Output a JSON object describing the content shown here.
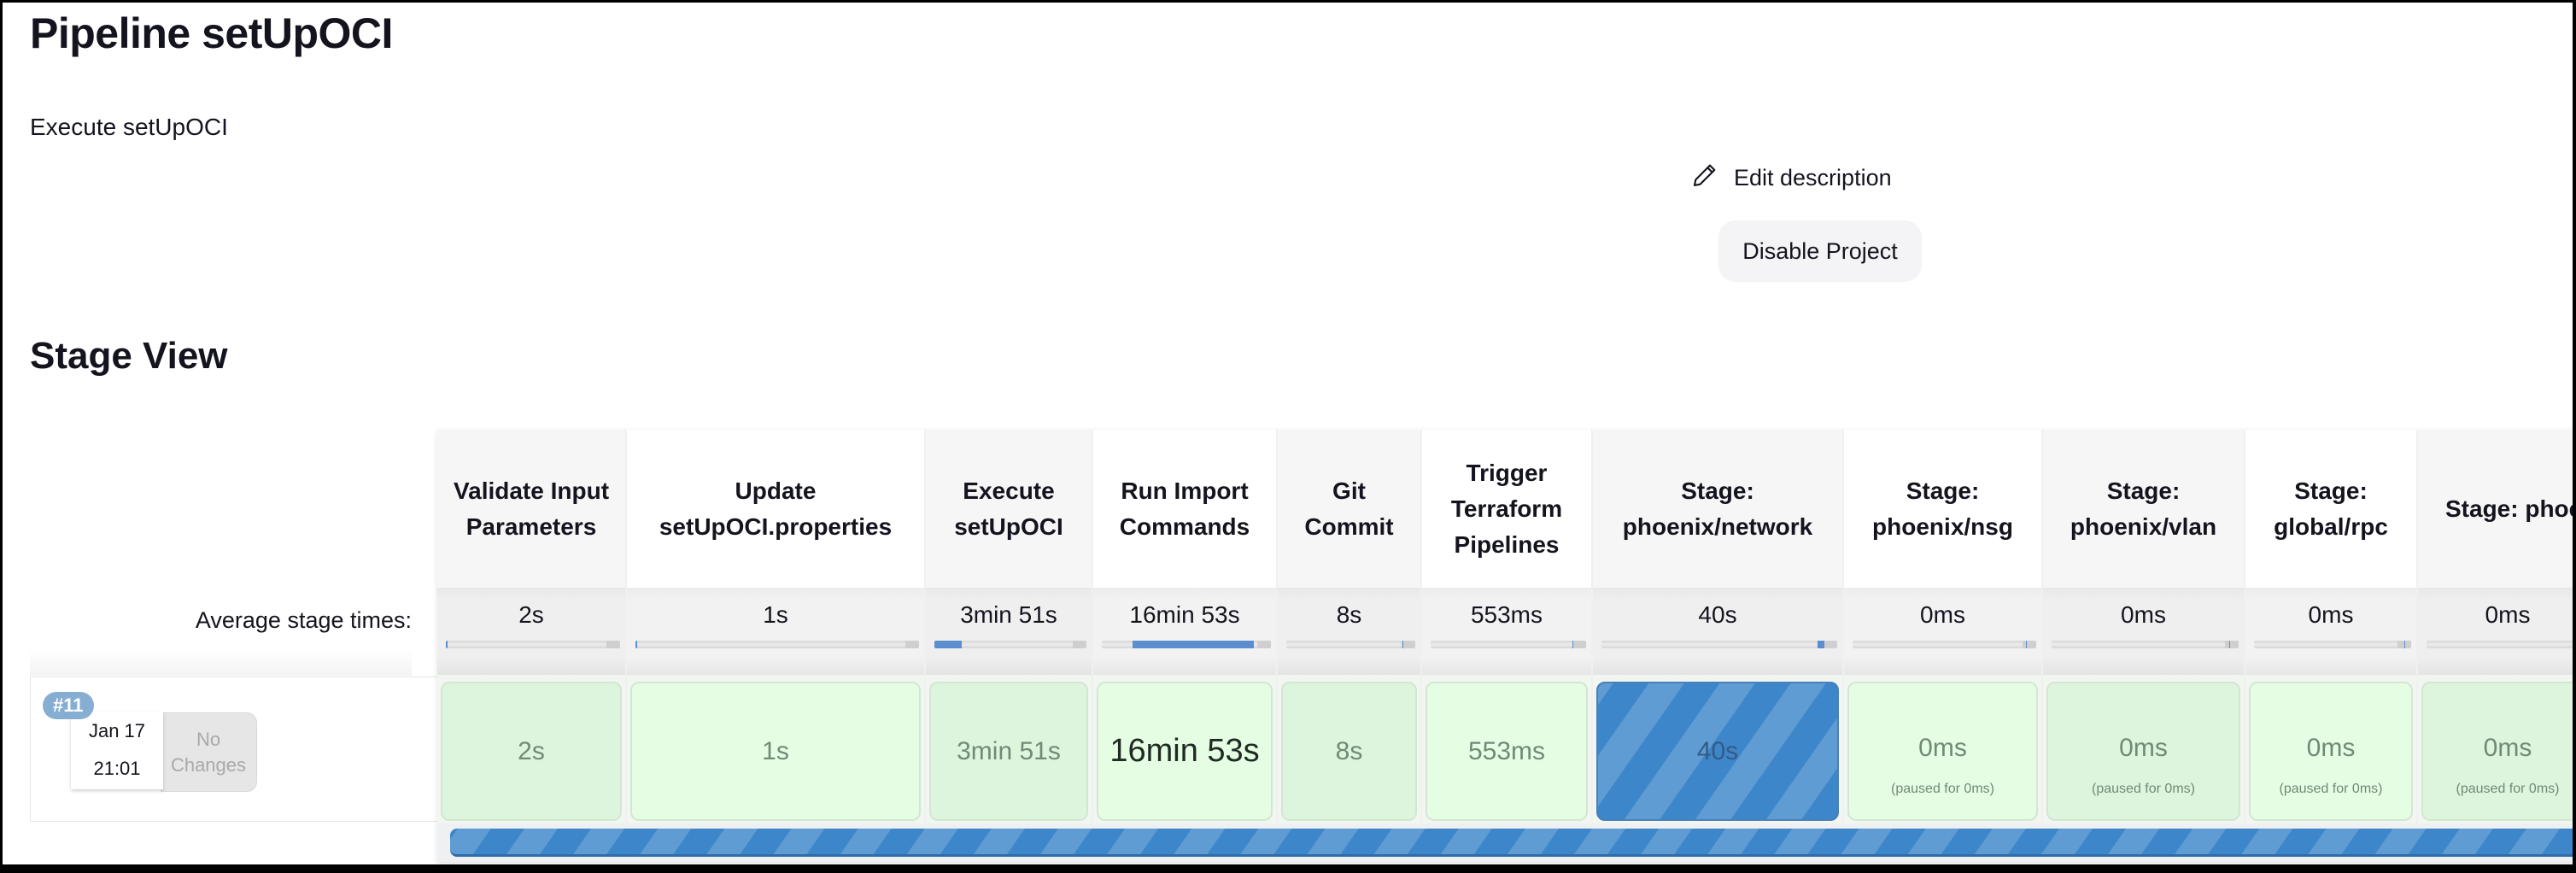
{
  "page": {
    "title": "Pipeline setUpOCI",
    "description": "Execute setUpOCI",
    "edit_description_label": "Edit description",
    "edit_description_icon": "pencil-icon",
    "disable_project_label": "Disable Project"
  },
  "stage_view": {
    "title": "Stage View",
    "average_label": "Average stage times:",
    "stages": [
      {
        "name": "Validate Input Parameters",
        "avg": "2s",
        "avg_fill": {
          "start": 0.0,
          "end": 0.01
        },
        "build_time": "2s",
        "paused": ""
      },
      {
        "name": "Update setUpOCI.properties",
        "avg": "1s",
        "avg_fill": {
          "start": 0.0,
          "end": 0.005
        },
        "build_time": "1s",
        "paused": ""
      },
      {
        "name": "Execute setUpOCI",
        "avg": "3min 51s",
        "avg_fill": {
          "start": 0.0,
          "end": 0.18
        },
        "build_time": "3min 51s",
        "paused": ""
      },
      {
        "name": "Run Import Commands",
        "avg": "16min 53s",
        "avg_fill": {
          "start": 0.18,
          "end": 0.9
        },
        "build_time": "16min 53s",
        "paused": ""
      },
      {
        "name": "Git Commit",
        "avg": "8s",
        "avg_fill": {
          "start": 0.9,
          "end": 0.91
        },
        "build_time": "8s",
        "paused": ""
      },
      {
        "name": "Trigger Terraform Pipelines",
        "avg": "553ms",
        "avg_fill": {
          "start": 0.91,
          "end": 0.915
        },
        "build_time": "553ms",
        "paused": ""
      },
      {
        "name": "Stage: phoenix/network",
        "avg": "40s",
        "avg_fill": {
          "start": 0.915,
          "end": 0.945
        },
        "build_time": "40s",
        "paused": "",
        "status": "running"
      },
      {
        "name": "Stage: phoenix/nsg",
        "avg": "0ms",
        "avg_fill": {
          "start": 0.945,
          "end": 0.95
        },
        "build_time": "0ms",
        "paused": "(paused for 0ms)"
      },
      {
        "name": "Stage: phoenix/vlan",
        "avg": "0ms",
        "avg_fill": {
          "start": 0.95,
          "end": 0.955
        },
        "build_time": "0ms",
        "paused": "(paused for 0ms)"
      },
      {
        "name": "Stage: global/rpc",
        "avg": "0ms",
        "avg_fill": {
          "start": 0.955,
          "end": 0.96
        },
        "build_time": "0ms",
        "paused": "(paused for 0ms)"
      },
      {
        "name": "Stage: phoenix/com",
        "avg": "0ms",
        "avg_fill": {
          "start": 0.96,
          "end": 0.965
        },
        "build_time": "0ms",
        "paused": "(paused for 0ms)"
      }
    ],
    "build": {
      "number": "#11",
      "date": "Jan 17",
      "time": "21:01",
      "changes": "No Changes",
      "progress": 1.0
    }
  },
  "colors": {
    "running_blue": "#3d86c9",
    "success_green": "#ddf5dd",
    "badge_blue": "#86aed2"
  }
}
